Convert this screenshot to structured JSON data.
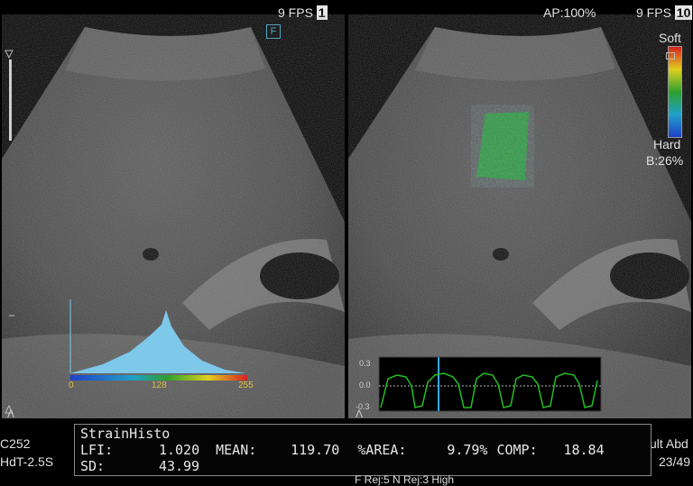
{
  "left_panel": {
    "fps": "9 FPS",
    "frame": "1",
    "focus_marker": "F",
    "histogram_axis": [
      "0",
      "128",
      "255"
    ]
  },
  "right_panel": {
    "ap": "AP:100%",
    "fps": "9 FPS",
    "frame": "10",
    "scale_top": "Soft",
    "scale_bottom": "Hard",
    "b_value": "B:26%",
    "graph_ticks": [
      "0.3",
      "0.0",
      "-0.3"
    ]
  },
  "left_side": {
    "line1": "C252",
    "line2": "HdT-2.5S"
  },
  "right_side": {
    "line1": "ult Abd",
    "line2": "23/49"
  },
  "strain_histo": {
    "title": "StrainHisto",
    "lfi_label": "LFI:",
    "lfi_value": "1.020",
    "mean_label": "MEAN:",
    "mean_value": "119.70",
    "area_label": "%AREA:",
    "area_value": "9.79%",
    "comp_label": "COMP:",
    "comp_value": "18.84",
    "sd_label": "SD:",
    "sd_value": "43.99"
  },
  "bottom_status": "F Rej:5 N Rej:3 High",
  "colors": {
    "histogram_fill": "#7ec8ea",
    "strain_soft": "#d62020",
    "strain_mid": "#2ea02e",
    "strain_hard": "#2040c8",
    "graph_line": "#22c022",
    "graph_marker": "#2aa8e0"
  }
}
